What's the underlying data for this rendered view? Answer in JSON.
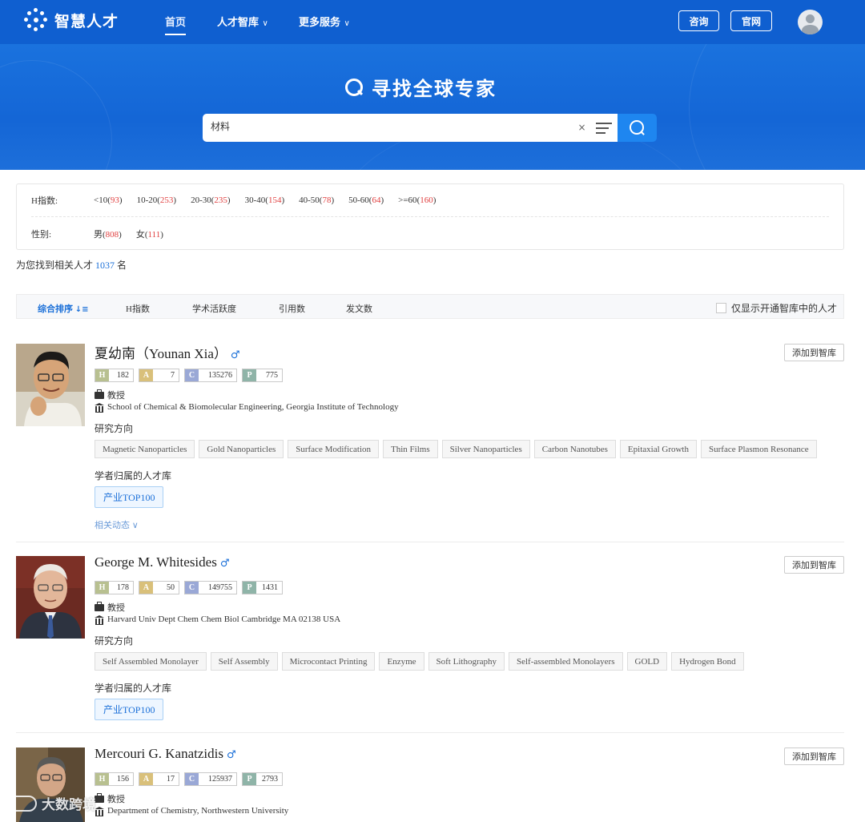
{
  "nav": {
    "brand": "智慧人才",
    "home": "首页",
    "talent_lib": "人才智库",
    "more_services": "更多服务",
    "consult": "咨询",
    "official": "官网",
    "chevron": "∨"
  },
  "hero": {
    "title": "寻找全球专家",
    "search_value": "材料",
    "clear": "×"
  },
  "filters": {
    "h_label": "H指数:",
    "h_options": [
      {
        "label": "<10",
        "count": "93"
      },
      {
        "label": "10-20",
        "count": "253"
      },
      {
        "label": "20-30",
        "count": "235"
      },
      {
        "label": "30-40",
        "count": "154"
      },
      {
        "label": "40-50",
        "count": "78"
      },
      {
        "label": "50-60",
        "count": "64"
      },
      {
        "label": ">=60",
        "count": "160"
      }
    ],
    "gender_label": "性别:",
    "gender_options": [
      {
        "label": "男",
        "count": "808"
      },
      {
        "label": "女",
        "count": "111"
      }
    ]
  },
  "result": {
    "prefix": "为您找到相关人才",
    "count": "1037",
    "suffix": "名"
  },
  "sort": {
    "comprehensive": "综合排序",
    "h_index": "H指数",
    "activity": "学术活跃度",
    "citations": "引用数",
    "papers": "发文数",
    "only_open": "仅显示开通智库中的人才"
  },
  "common": {
    "add_button": "添加到智库",
    "research_label": "研究方向",
    "library_label": "学者归属的人才库",
    "related": "相关动态",
    "h": "H",
    "a": "A",
    "c": "C",
    "p": "P"
  },
  "people": [
    {
      "name": "夏幼南（Younan Xia）",
      "gender": "♂",
      "h": "182",
      "a": "7",
      "c": "135276",
      "p": "775",
      "title": "教授",
      "institution": "School of Chemical & Biomolecular Engineering, Georgia Institute of Technology",
      "tags": [
        "Magnetic Nanoparticles",
        "Gold Nanoparticles",
        "Surface Modification",
        "Thin Films",
        "Silver Nanoparticles",
        "Carbon Nanotubes",
        "Epitaxial Growth",
        "Surface Plasmon Resonance"
      ],
      "library": "产业TOP100"
    },
    {
      "name": "George M. Whitesides",
      "gender": "♂",
      "h": "178",
      "a": "50",
      "c": "149755",
      "p": "1431",
      "title": "教授",
      "institution": "Harvard Univ Dept Chem Chem Biol Cambridge MA 02138 USA",
      "tags": [
        "Self Assembled Monolayer",
        "Self Assembly",
        "Microcontact Printing",
        "Enzyme",
        "Soft Lithography",
        "Self-assembled Monolayers",
        "GOLD",
        "Hydrogen Bond"
      ],
      "library": "产业TOP100"
    },
    {
      "name": "Mercouri G. Kanatzidis",
      "gender": "♂",
      "h": "156",
      "a": "17",
      "c": "125937",
      "p": "2793",
      "title": "教授",
      "institution": "Department of Chemistry, Northwestern University"
    }
  ],
  "watermark": "大数跨境"
}
